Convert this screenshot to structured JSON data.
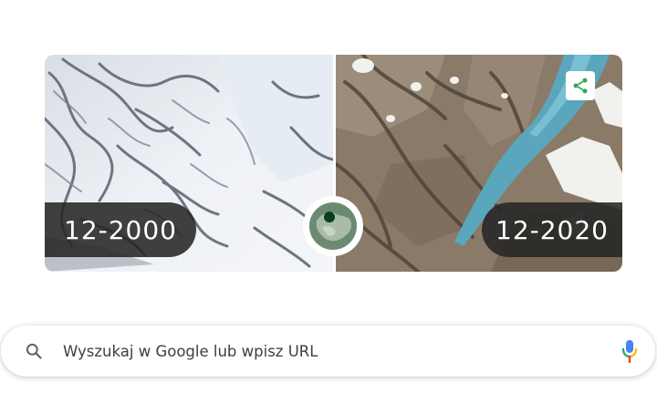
{
  "doodle": {
    "before_year": "12-2000",
    "after_year": "12-2020",
    "share_icon": "share-icon",
    "globe_icon": "globe-icon"
  },
  "search": {
    "placeholder": "Wyszukaj w Google lub wpisz URL",
    "search_icon": "search-icon",
    "mic_icon": "microphone-icon"
  },
  "colors": {
    "badge_bg": "#262626",
    "share_green": "#34a853",
    "globe_water": "#5b7a63",
    "globe_dot": "#0d3d1f",
    "mic_blue": "#4285f4",
    "mic_red": "#ea4335",
    "mic_yellow": "#fbbc04",
    "mic_green": "#34a853"
  }
}
